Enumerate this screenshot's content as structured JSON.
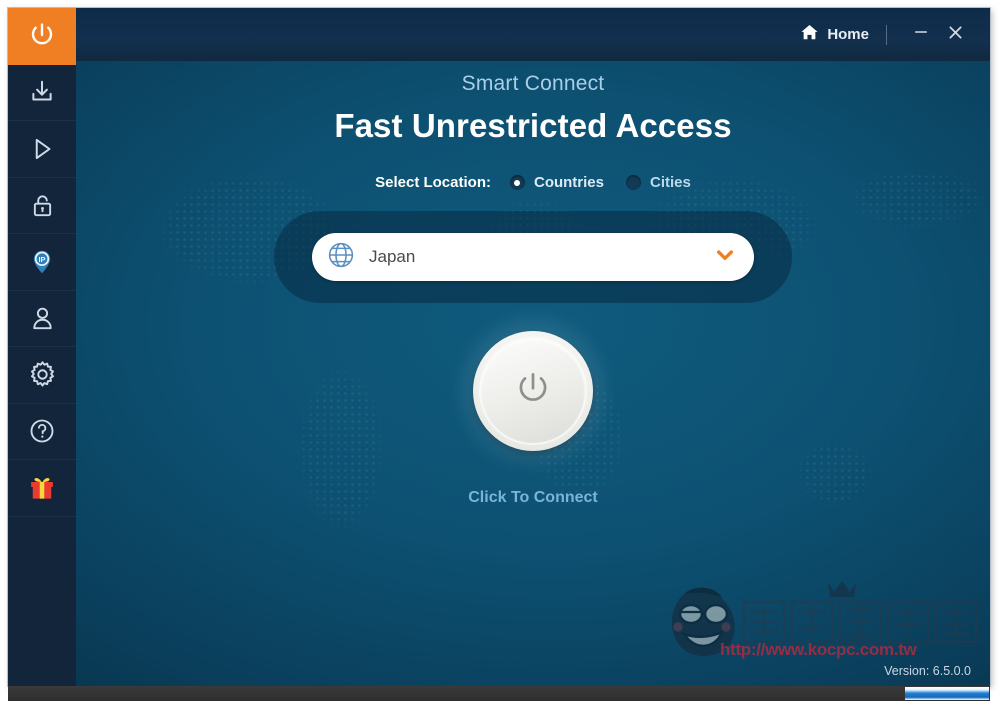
{
  "window": {
    "titlebar": {
      "home_label": "Home",
      "home_icon": "home-icon",
      "minimize_icon": "minimize-icon",
      "close_icon": "close-icon"
    }
  },
  "sidebar": {
    "items": [
      {
        "name": "power",
        "icon": "power-icon",
        "active": true
      },
      {
        "name": "download",
        "icon": "download-icon",
        "active": false
      },
      {
        "name": "streaming",
        "icon": "play-icon",
        "active": false
      },
      {
        "name": "security",
        "icon": "lock-icon",
        "active": false
      },
      {
        "name": "ip-address",
        "icon": "ip-pin-icon",
        "active": false
      },
      {
        "name": "account",
        "icon": "user-icon",
        "active": false
      },
      {
        "name": "settings",
        "icon": "gear-icon",
        "active": false
      },
      {
        "name": "help",
        "icon": "question-icon",
        "active": false
      },
      {
        "name": "gift",
        "icon": "gift-icon",
        "active": false
      }
    ]
  },
  "main": {
    "subtitle": "Smart Connect",
    "headline": "Fast Unrestricted Access",
    "location": {
      "label": "Select Location:",
      "options": [
        {
          "label": "Countries",
          "selected": true
        },
        {
          "label": "Cities",
          "selected": false
        }
      ]
    },
    "dropdown": {
      "value": "Japan",
      "globe_icon": "globe-icon",
      "chevron_icon": "chevron-down-icon",
      "chevron_color": "#f07e22"
    },
    "power_button": {
      "icon": "power-icon",
      "caption": "Click To Connect"
    }
  },
  "footer": {
    "version": "Version: 6.5.0.0"
  },
  "watermark": {
    "site_name": "電腦王阿達",
    "url": "http://www.kocpc.com.tw"
  },
  "colors": {
    "accent_orange": "#f07e22",
    "sidebar_bg": "#12253b",
    "titlebar_bg": "#12304e",
    "content_bg": "#0d5172",
    "link_blue": "#7ab4dd"
  }
}
